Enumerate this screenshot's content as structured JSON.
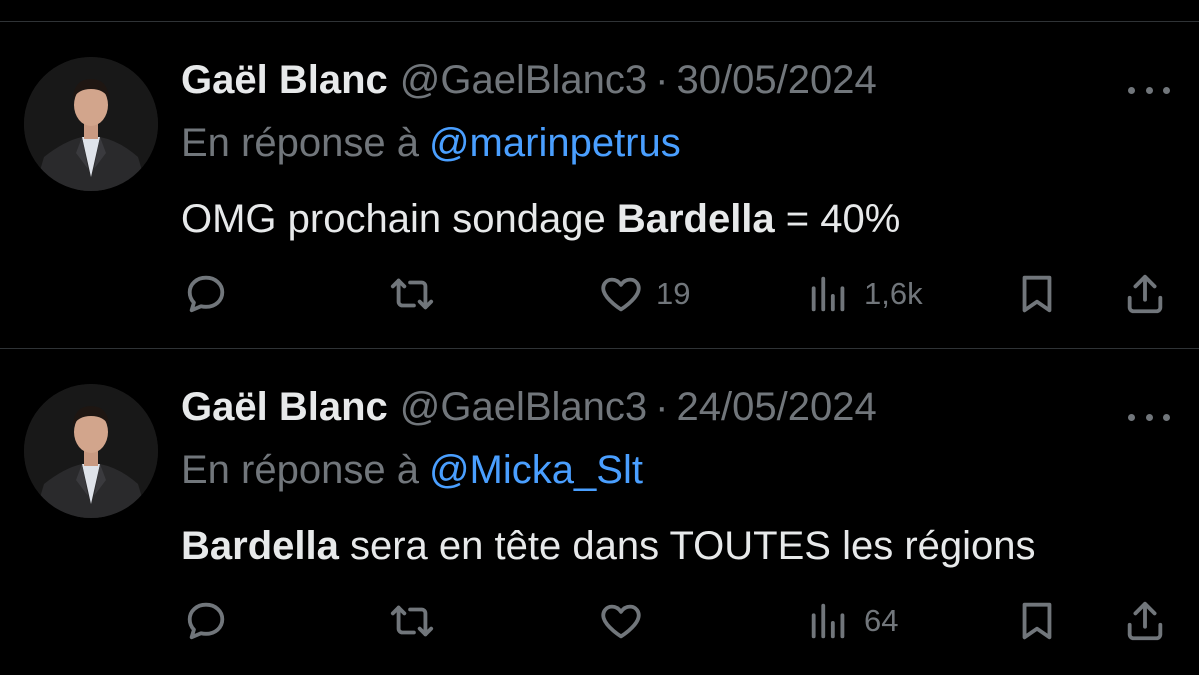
{
  "tweets": [
    {
      "author_name": "Gaël Blanc",
      "handle": "@GaelBlanc3",
      "separator": "·",
      "date": "30/05/2024",
      "reply_prefix": "En réponse à",
      "reply_to": "@marinpetrus",
      "text_parts": [
        "OMG prochain sondage ",
        "Bardella",
        " = 40%"
      ],
      "likes": "19",
      "views": "1,6k"
    },
    {
      "author_name": "Gaël Blanc",
      "handle": "@GaelBlanc3",
      "separator": "·",
      "date": "24/05/2024",
      "reply_prefix": "En réponse à",
      "reply_to": "@Micka_Slt",
      "text_parts": [
        "",
        "Bardella",
        " sera en tête dans TOUTES les régions"
      ],
      "likes": "",
      "views": "64"
    }
  ],
  "icons": {
    "more": "more-dots-icon",
    "reply": "reply-icon",
    "retweet": "retweet-icon",
    "like": "heart-icon",
    "views": "views-icon",
    "bookmark": "bookmark-icon",
    "share": "share-icon"
  },
  "colors": {
    "background": "#000000",
    "text": "#e7e9ea",
    "muted": "#71767b",
    "link": "#4a9fff",
    "divider": "#2f3336"
  }
}
